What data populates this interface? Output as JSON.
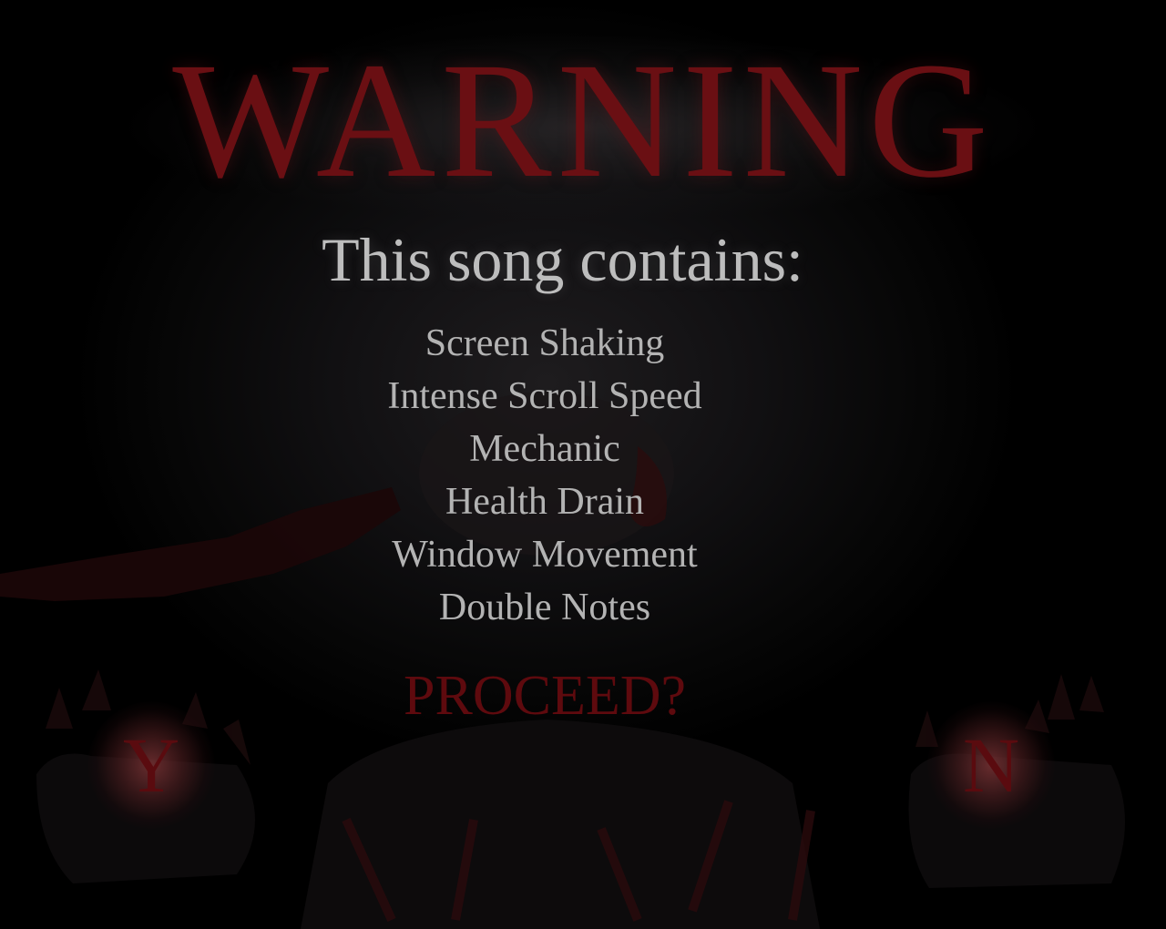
{
  "screen": {
    "title": "WARNING",
    "subtitle": "This song contains:",
    "warnings": [
      "Screen Shaking",
      "Intense Scroll Speed",
      "Mechanic",
      "Health Drain",
      "Window Movement",
      "Double Notes"
    ],
    "prompt": "PROCEED?",
    "yes_key": "Y",
    "no_key": "N"
  },
  "colors": {
    "title": "#6a0f13",
    "text": "#b3b3b3",
    "prompt": "#5e0a0e",
    "background": "#000000"
  }
}
